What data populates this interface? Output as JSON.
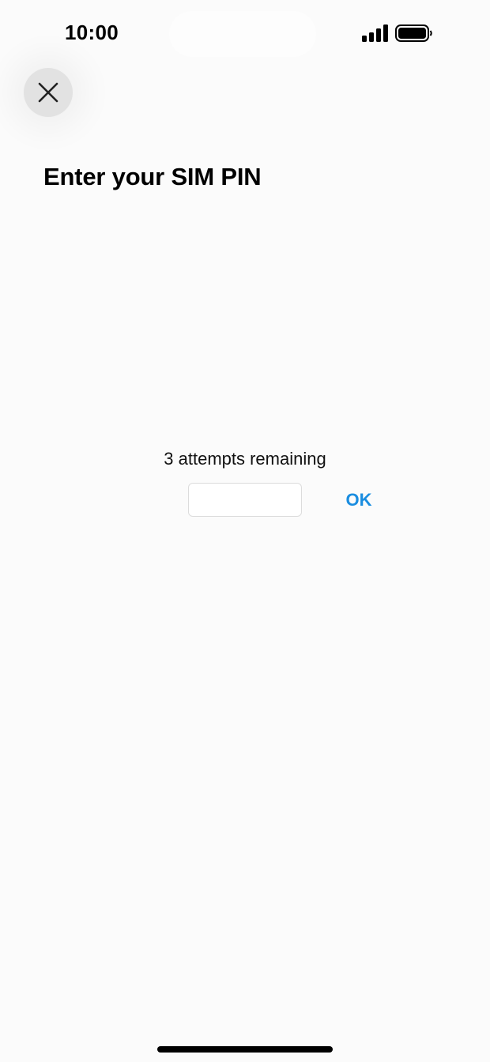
{
  "status_bar": {
    "time": "10:00",
    "signal_icon": "cellular-signal-icon",
    "battery_icon": "battery-full-icon"
  },
  "close_button": {
    "icon": "close-icon"
  },
  "title": "Enter your SIM PIN",
  "attempts": "3 attempts remaining",
  "pin_input": {
    "value": "",
    "placeholder": ""
  },
  "ok_label": "OK",
  "colors": {
    "accent": "#1a8de0",
    "background": "#fbfbfb",
    "close_button_bg": "#e2e2e2"
  }
}
